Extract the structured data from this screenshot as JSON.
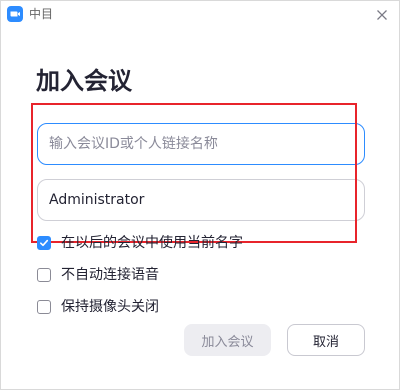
{
  "window": {
    "title": "中目",
    "accent_color": "#2d8cff",
    "annotation_color": "#e8242b"
  },
  "dialog": {
    "heading": "加入会议",
    "meeting_id_input": {
      "value": "",
      "placeholder": "输入会议ID或个人链接名称"
    },
    "name_input": {
      "value": "Administrator",
      "placeholder": ""
    },
    "options": [
      {
        "label": "在以后的会议中使用当前名字",
        "checked": true
      },
      {
        "label": "不自动连接语音",
        "checked": false
      },
      {
        "label": "保持摄像头关闭",
        "checked": false
      }
    ],
    "buttons": {
      "join_label": "加入会议",
      "join_enabled": false,
      "cancel_label": "取消"
    }
  },
  "icons": {
    "app": "zoom-camera-icon",
    "close": "close-icon",
    "check": "checkmark-icon"
  }
}
